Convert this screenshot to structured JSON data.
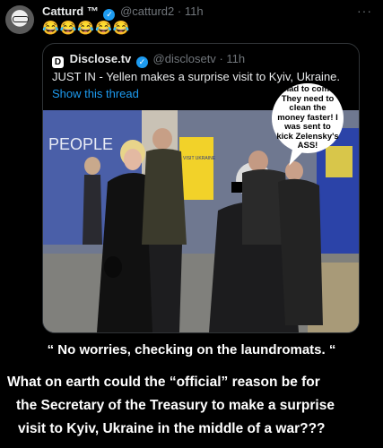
{
  "tweet": {
    "display_name": "Catturd ™",
    "handle": "@catturd2",
    "time": "11h",
    "more": "···",
    "emojis": "😂😂😂😂😂"
  },
  "quoted": {
    "display_name": "Disclose.tv",
    "handle": "@disclosetv",
    "time": "11h",
    "text": "JUST IN - Yellen makes a surprise visit to Kyiv, Ukraine.",
    "show_thread": "Show this thread",
    "photo": {
      "sign_text": "PEOPLE",
      "sign_text_2": "VISIT UKRAINE",
      "speech_bubble": "I had to come. They need to clean the money faster! I was sent to kick Zelensky's ASS!"
    }
  },
  "caption": {
    "line1": "“ No worries, checking on the laundromats. “",
    "line2_a": "What on earth could the “official” reason be for",
    "line2_b": "the Secretary of the Treasury to make a surprise",
    "line2_c": "visit to Kyiv, Ukraine in the middle of a war???"
  },
  "colors": {
    "accent": "#1d9bf0",
    "background": "#000000",
    "muted": "#71767b"
  }
}
